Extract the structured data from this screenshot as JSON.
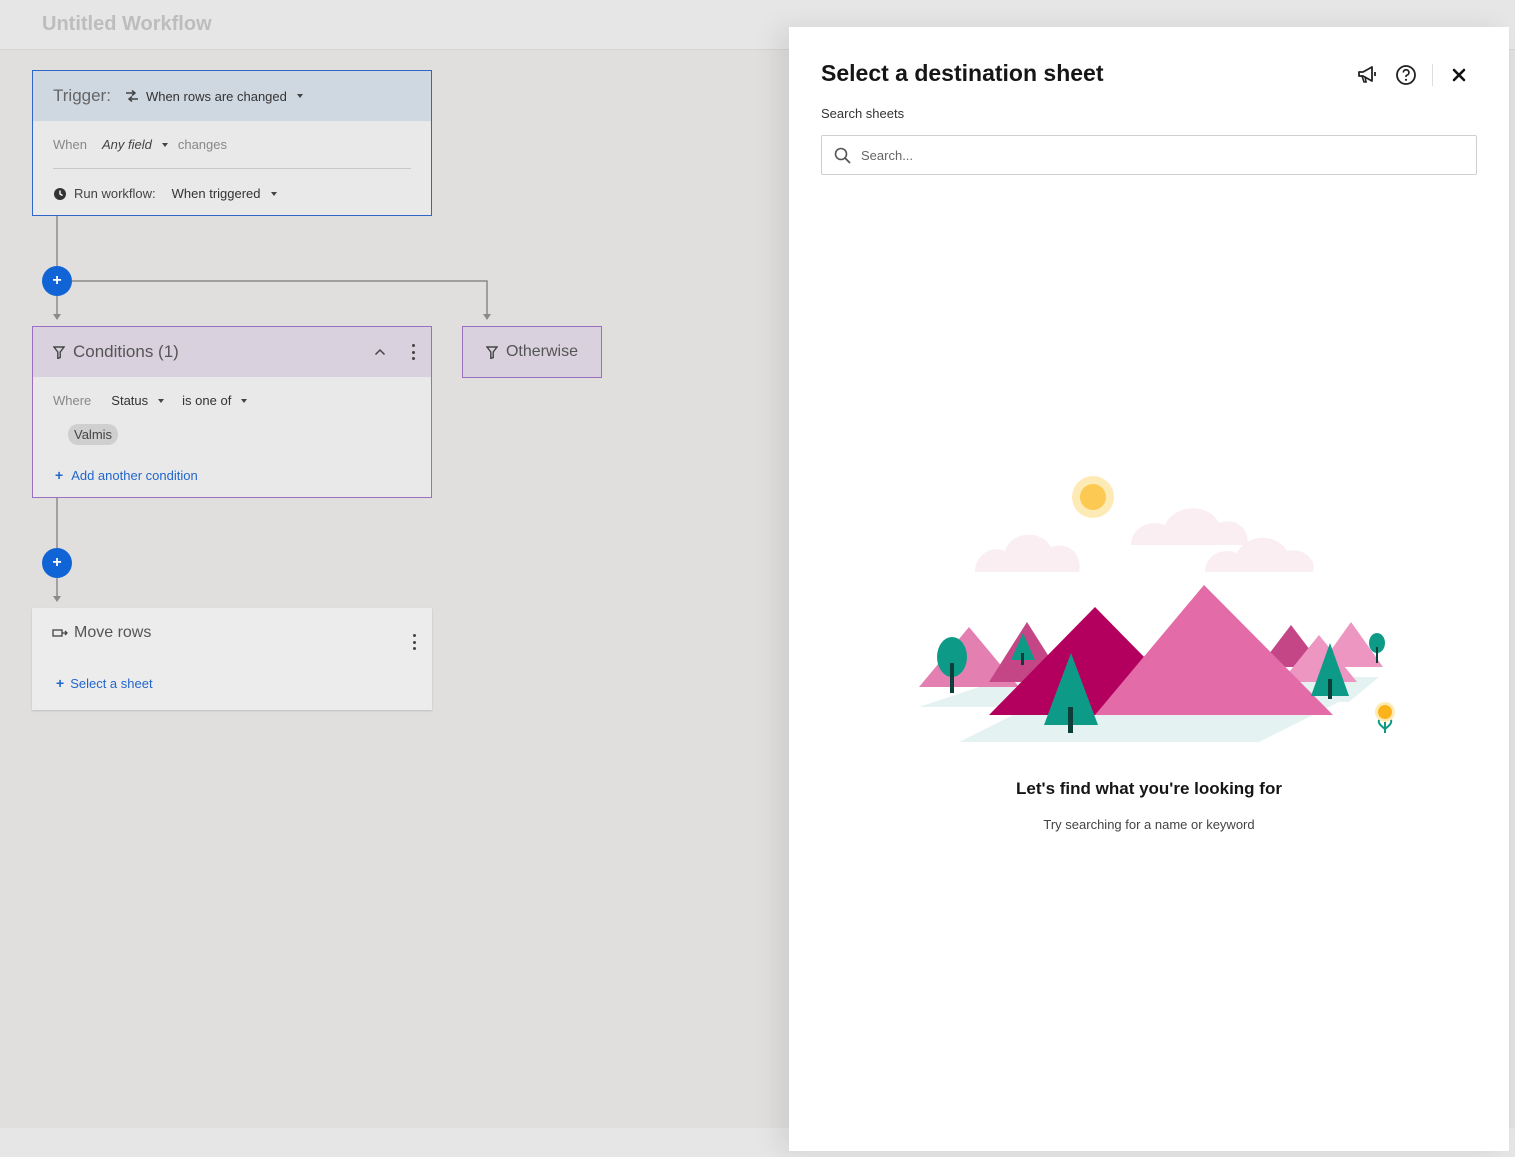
{
  "workflow": {
    "title": "Untitled Workflow"
  },
  "trigger": {
    "label": "Trigger:",
    "event": "When rows are changed",
    "when_label": "When",
    "field": "Any field",
    "changes_label": "changes",
    "run_label": "Run workflow:",
    "run_value": "When triggered"
  },
  "conditions": {
    "title": "Conditions (1)",
    "where_label": "Where",
    "field": "Status",
    "operator": "is one of",
    "value_chip": "Valmis",
    "add_label": "Add another condition"
  },
  "otherwise": {
    "label": "Otherwise"
  },
  "move_rows": {
    "title": "Move rows",
    "select_label": "Select a sheet"
  },
  "panel": {
    "title": "Select a destination sheet",
    "search_label": "Search sheets",
    "search_placeholder": "Search...",
    "empty_title": "Let's find what you're looking for",
    "empty_subtitle": "Try searching for a name or keyword"
  },
  "colors": {
    "accent": "#1064d6",
    "trigger_border": "#2e66c9",
    "condition_border": "#9b70c0"
  },
  "icons": [
    "swap-icon",
    "clock-icon",
    "filter-icon",
    "chevron-up-icon",
    "kebab-icon",
    "move-rows-icon",
    "plus-icon",
    "megaphone-icon",
    "help-icon",
    "close-icon",
    "search-icon"
  ]
}
